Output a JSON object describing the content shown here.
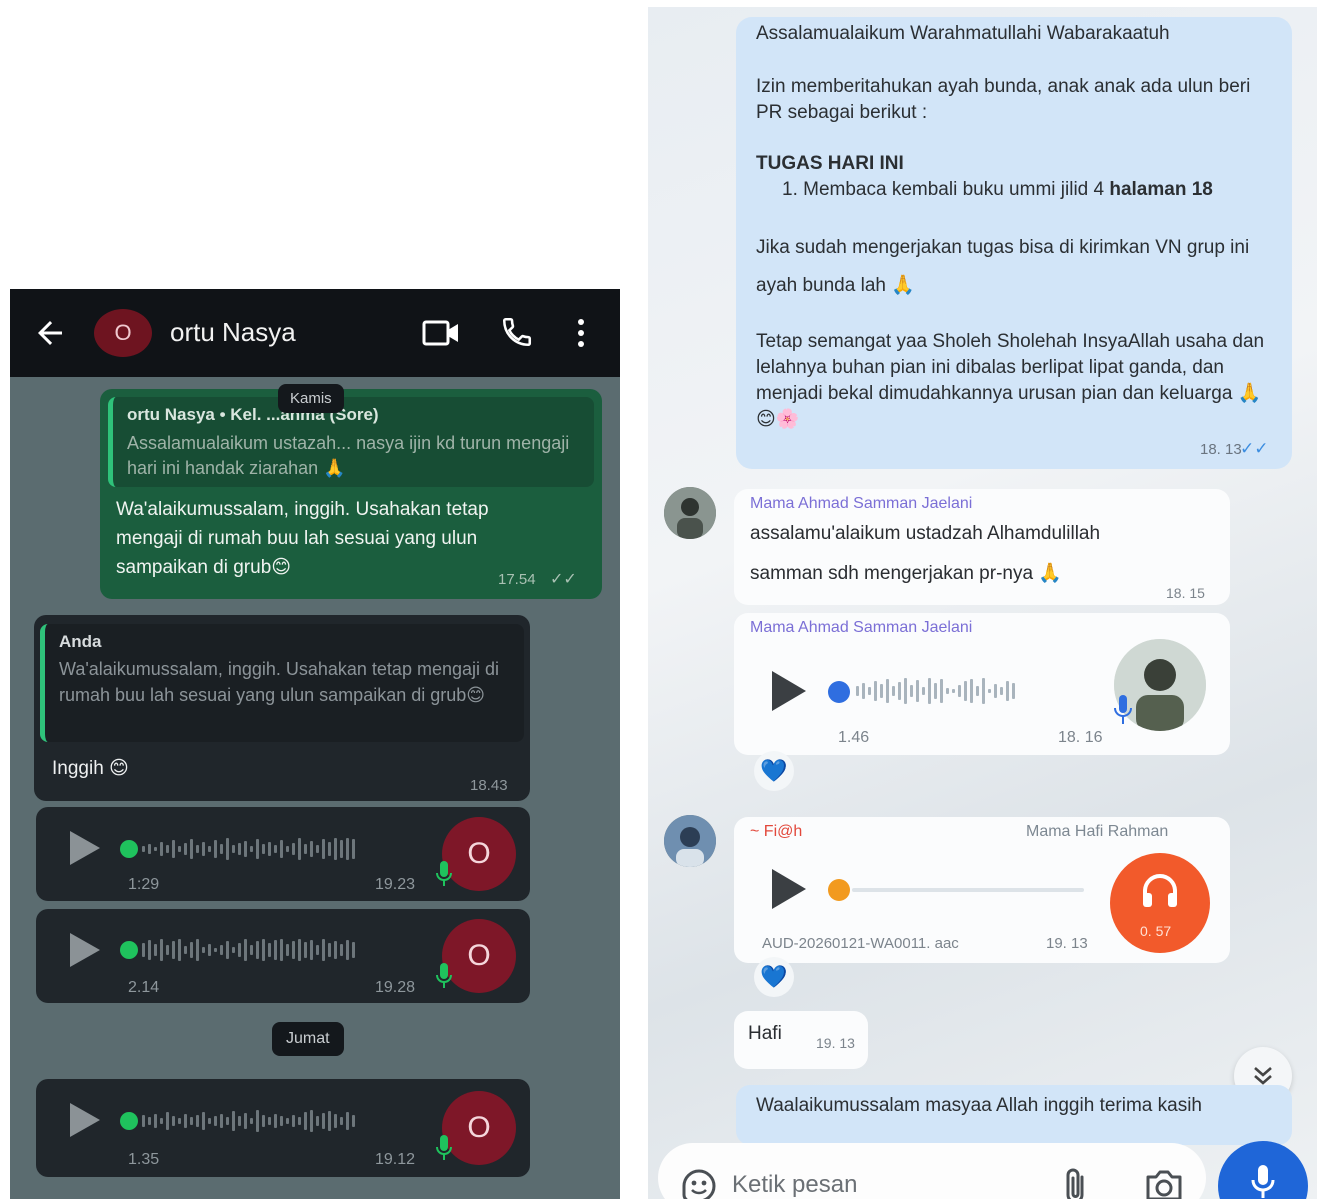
{
  "left": {
    "header": {
      "title": "ortu Nasya",
      "avatar_letter": "O"
    },
    "reply1": {
      "quote_author": "ortu Nasya • Kel. ...ahma (Sore)",
      "quote_text": "Assalamualaikum ustazah... nasya ijin kd turun mengaji hari ini handak ziarahan 🙏",
      "body": "Wa'alaikumussalam, inggih. Usahakan tetap mengaji di rumah buu lah sesuai yang ulun sampaikan di grub😊",
      "time": "17.54"
    },
    "day_label_1": "Kamis",
    "reply2": {
      "quote_author": "Anda",
      "quote_text": "Wa'alaikumussalam, inggih. Usahakan tetap mengaji di rumah buu lah sesuai yang ulun sampaikan di grub😊",
      "body": "Inggih 😊",
      "time": "18.43"
    },
    "voice_notes": [
      {
        "duration": "1:29",
        "time": "19.23",
        "avatar_letter": "O"
      },
      {
        "duration": "2.14",
        "time": "19.28",
        "avatar_letter": "O"
      },
      {
        "duration": "1.35",
        "time": "19.12",
        "avatar_letter": "O"
      }
    ],
    "day_label_2": "Jumat",
    "accent_green": "#1fc25d"
  },
  "right": {
    "announcement": {
      "line1": "Assalamualaikum Warahmatullahi Wabarakaatuh",
      "line2": "Izin memberitahukan ayah bunda,  anak anak ada ulun beri PR sebagai berikut :",
      "heading": "TUGAS HARI INI",
      "item_prefix": "1.  Membaca kembali buku ummi jilid 4 ",
      "item_bold": "halaman 18",
      "line3": "Jika sudah mengerjakan tugas bisa di kirimkan VN grup ini ayah bunda lah 🙏",
      "line4": "Tetap semangat yaa Sholeh Sholehah InsyaAllah usaha dan lelahnya buhan pian ini dibalas berlipat lipat ganda,  dan menjadi bekal dimudahkannya urusan pian dan keluarga 🙏😊🌸",
      "time": "18. 13"
    },
    "msg_text": {
      "sender": "Mama Ahmad Samman Jaelani",
      "line1": "assalamu'alaikum ustadzah Alhamdulillah",
      "line2": "samman sdh mengerjakan  pr-nya 🙏",
      "time": "18. 15"
    },
    "msg_voice": {
      "sender": "Mama Ahmad Samman Jaelani",
      "duration": "1.46",
      "time": "18. 16"
    },
    "msg_audio": {
      "sender": "~ Fi@h",
      "sender_alias": "Mama Hafi Rahman",
      "filename": "AUD-20260121-WA0011. aac",
      "time": "19. 13",
      "badge": "0. 57"
    },
    "msg_hafi": {
      "text": "Hafi",
      "time": "19. 13"
    },
    "partial": {
      "text": "Waalaikumussalam masyaa Allah inggih terima kasih"
    },
    "input": {
      "placeholder": "Ketik pesan"
    },
    "reaction": "💙"
  }
}
